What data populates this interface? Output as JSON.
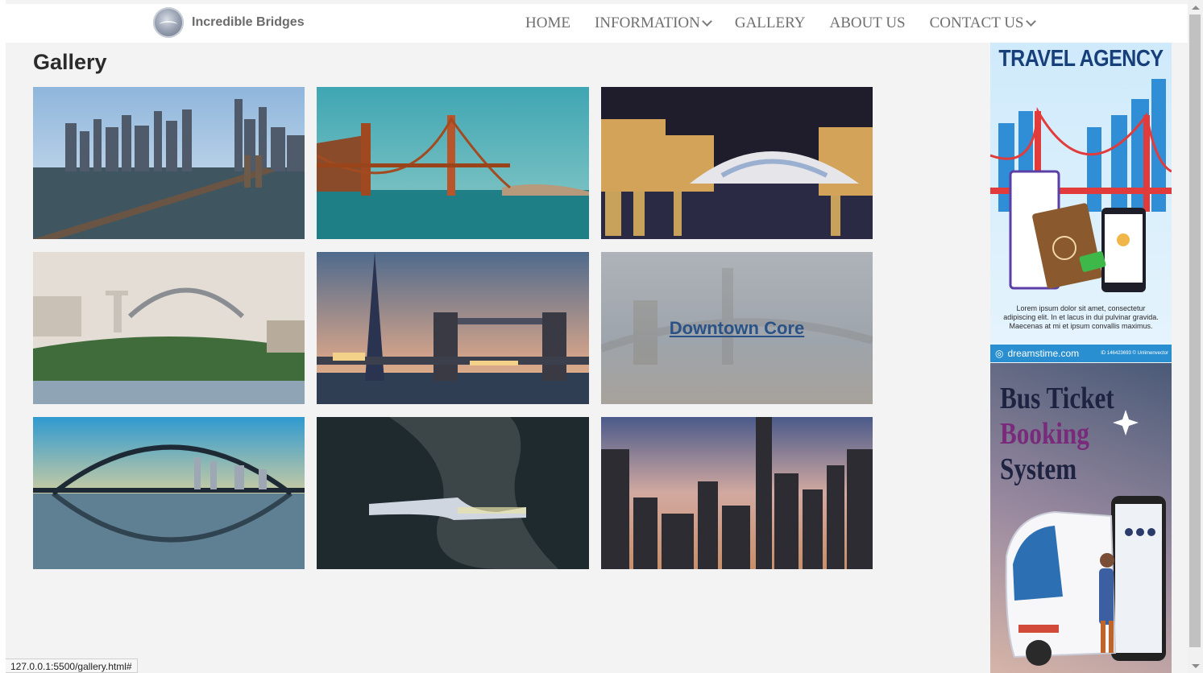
{
  "header": {
    "brand": "Incredible Bridges",
    "nav": [
      {
        "label": "HOME",
        "dropdown": false
      },
      {
        "label": "INFORMATION",
        "dropdown": true
      },
      {
        "label": "GALLERY",
        "dropdown": false
      },
      {
        "label": "ABOUT US",
        "dropdown": false
      },
      {
        "label": "CONTACT US",
        "dropdown": true
      }
    ]
  },
  "main": {
    "title": "Gallery",
    "hover_caption": "Downtown Core"
  },
  "ads": {
    "travel": {
      "title": "TRAVEL AGENCY",
      "body": "Lorem ipsum dolor sit amet, consectetur adipiscing elit. In et lacus in dui pulvinar gravida. Maecenas at mi et ipsum convallis maximus.",
      "footer": "dreamstime.com",
      "footer_id": "ID 146423693 © Unlimenvector"
    },
    "bus": {
      "line1": "Bus Ticket",
      "line2": "Booking",
      "line3": "System"
    }
  },
  "status_bar": "127.0.0.1:5500/gallery.html#"
}
